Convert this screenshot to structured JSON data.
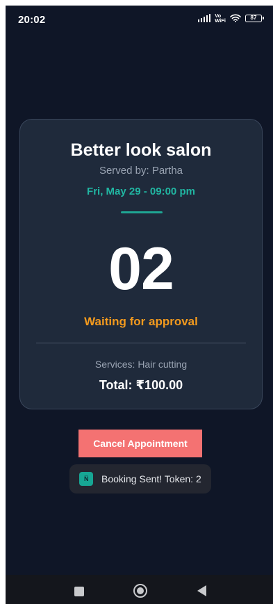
{
  "status_bar": {
    "time": "20:02",
    "network_label_top": "Vo",
    "network_label_bottom": "WiFi",
    "battery": "87"
  },
  "appointment": {
    "salon_name": "Better look salon",
    "served_by": "Served by: Partha",
    "date_time": "Fri, May 29 - 09:00 pm",
    "token_number": "02",
    "status": "Waiting for approval",
    "services": "Services: Hair cutting",
    "total": "Total: ₹100.00"
  },
  "actions": {
    "cancel_label": "Cancel Appointment"
  },
  "toast": {
    "app_logo_text": "N̅",
    "message": "Booking Sent! Token: 2"
  },
  "colors": {
    "background": "#0f1627",
    "card": "#1f2a3b",
    "accent_teal": "#21b6a2",
    "status_orange": "#f39a1e",
    "cancel_button": "#f47272"
  },
  "icons": {
    "signal": "signal-bars-icon",
    "vowifi": "vowifi-icon",
    "wifi": "wifi-icon",
    "battery": "battery-icon",
    "recents": "square-recents-icon",
    "home": "circle-home-icon",
    "back": "triangle-back-icon"
  }
}
